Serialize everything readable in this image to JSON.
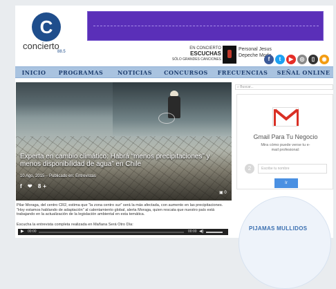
{
  "header": {
    "logo_letter": "C",
    "logo_name": "concierto",
    "logo_freq": "88.5",
    "now_playing": {
      "label_top": "EN CONCIERTO",
      "program": "ESCUCHAS",
      "tagline": "SÓLO GRANDES CANCIONES",
      "song": "Personal Jesus",
      "artist": "Depeche Mode"
    },
    "social_icons": [
      {
        "name": "facebook-icon",
        "glyph": "f",
        "color": "#3b5998"
      },
      {
        "name": "twitter-icon",
        "glyph": "t",
        "color": "#1da1f2"
      },
      {
        "name": "youtube-icon",
        "glyph": "▶",
        "color": "#e52d27"
      },
      {
        "name": "instagram-icon",
        "glyph": "◎",
        "color": "#8a8a8a"
      },
      {
        "name": "mobile-icon",
        "glyph": "▯",
        "color": "#333333"
      },
      {
        "name": "rss-icon",
        "glyph": "◉",
        "color": "#f39c12"
      }
    ]
  },
  "nav": {
    "items": [
      "Inicio",
      "Programas",
      "Noticias",
      "Concursos",
      "Frecuencias",
      "Señal Online"
    ]
  },
  "article": {
    "title": "Experta en cambio climático: Habrá “menos precipitaciones” y menos disponibilidad de agua” en Chile",
    "meta": "10 Ago, 2015 – Publicado en: Entrevistas",
    "share": "f ❤ 8+",
    "comments": "0",
    "paragraph": "Pilar Moraga, del centro CR2, estima que “la zona centro sur” será la más afectada, con aumento en las precipitaciones. “Hoy estamos hablando de adaptación” al calentamiento global, alerta Moraga, quien rescata que nuestro país está trabajando en la actualización de la legislación ambiental en esta temática.",
    "listen": "Escucha la entrevista completa realizada en Mañana Será Otro Día:",
    "player": {
      "time_start": "00:00",
      "time_end": "00:00"
    }
  },
  "sidebar": {
    "search_placeholder": "Buscar...",
    "ad": {
      "title": "Gmail Para Tu Negocio",
      "subtitle": "Mira cómo puede verse tu e-mail profesional:",
      "step": "2",
      "input_placeholder": "Escribe tu nombre",
      "button": "Ir"
    },
    "promo": "PIJAMAS MULLIDOS"
  }
}
